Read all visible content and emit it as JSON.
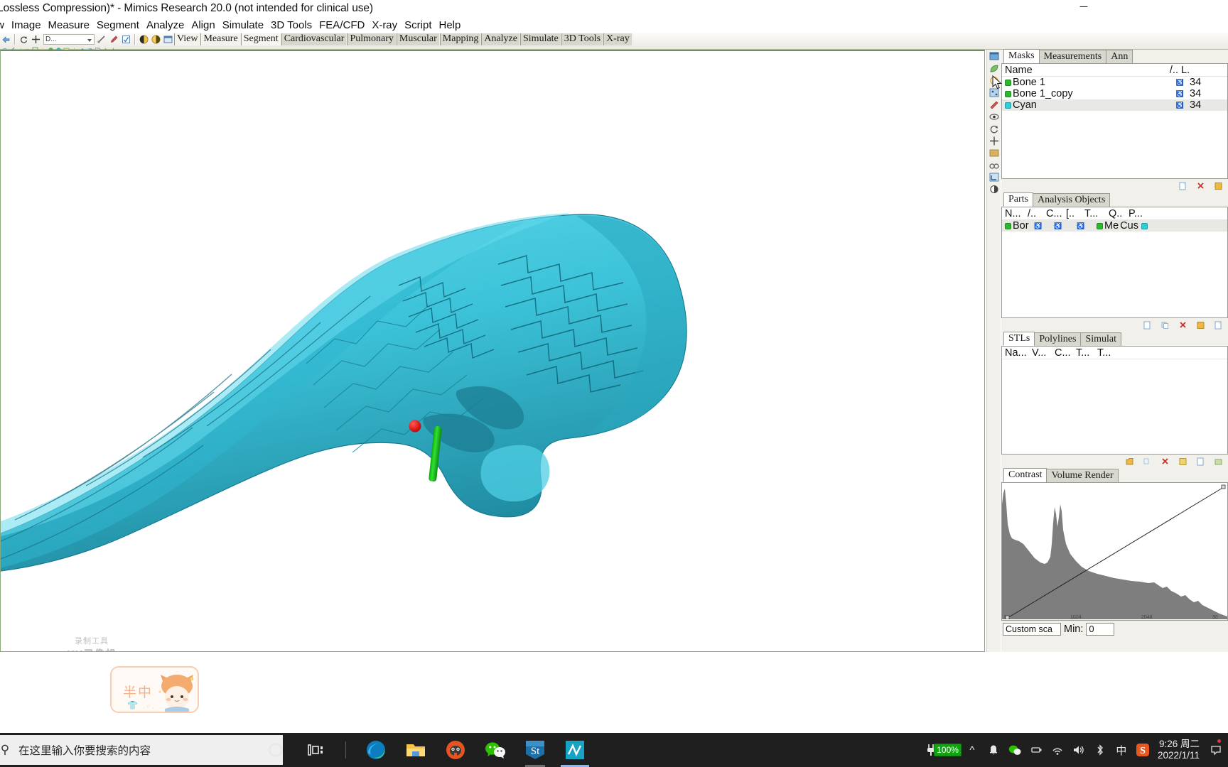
{
  "window": {
    "title": "Lossless Compression)* - Mimics Research 20.0 (not intended for clinical use)",
    "minimize_glyph": "─"
  },
  "menubar": {
    "items": [
      {
        "label": "w"
      },
      {
        "label": "Image"
      },
      {
        "label": "Measure"
      },
      {
        "label": "Segment"
      },
      {
        "label": "Analyze"
      },
      {
        "label": "Align"
      },
      {
        "label": "Simulate"
      },
      {
        "label": "3D Tools"
      },
      {
        "label": "FEA/CFD"
      },
      {
        "label": "X-ray"
      },
      {
        "label": "Script"
      },
      {
        "label": "Help"
      }
    ]
  },
  "toolbar": {
    "combo_value": "D...",
    "ribbon_tabs": [
      {
        "label": "View",
        "active": false
      },
      {
        "label": "Measure",
        "active": false
      },
      {
        "label": "Segment",
        "active": true
      },
      {
        "label": "Cardiovascular",
        "active": false
      },
      {
        "label": "Pulmonary",
        "active": false
      },
      {
        "label": "Muscular",
        "active": false
      },
      {
        "label": "Mapping",
        "active": false
      },
      {
        "label": "Analyze",
        "active": false
      },
      {
        "label": "Simulate",
        "active": false
      },
      {
        "label": "3D Tools",
        "active": false
      },
      {
        "label": "X-ray",
        "active": false
      }
    ]
  },
  "viewport": {
    "watermark_line1": "录制工具",
    "watermark_line2": "KK录像机",
    "mascot_text": "半中",
    "mascot_dots": ", ○ ,",
    "model_color": "#3fc6dd",
    "marker_color": "#e01b1b",
    "axis_color": "#1ec41e"
  },
  "masks_panel": {
    "tabs": [
      {
        "label": "Masks",
        "active": true
      },
      {
        "label": "Measurements",
        "active": false
      },
      {
        "label": "Ann",
        "active": false
      }
    ],
    "columns": [
      "Name",
      "/..",
      "L."
    ],
    "rows": [
      {
        "name": "Bone 1",
        "color": "#2eb82e",
        "visible": "♿",
        "lower": "34",
        "selected": false
      },
      {
        "name": "Bone 1_copy",
        "color": "#2eb82e",
        "visible": "♿",
        "lower": "34",
        "selected": false
      },
      {
        "name": "Cyan",
        "color": "#2ecfd8",
        "visible": "♿",
        "lower": "34",
        "selected": true
      }
    ]
  },
  "parts_panel": {
    "tabs": [
      {
        "label": "Parts",
        "active": true
      },
      {
        "label": "Analysis Objects",
        "active": false
      }
    ],
    "columns": [
      "N...",
      "/..",
      "C...",
      "[..",
      "T...",
      "Q..",
      "P..."
    ],
    "rows": [
      {
        "name": "Bor",
        "color": "#2eb82e",
        "t_value": "Me",
        "q_value": "Cus",
        "selected": true
      }
    ]
  },
  "stls_panel": {
    "tabs": [
      {
        "label": "STLs",
        "active": true
      },
      {
        "label": "Polylines",
        "active": false
      },
      {
        "label": "Simulat",
        "active": false
      }
    ],
    "columns": [
      "Na...",
      "V...",
      "C...",
      "T...",
      "T..."
    ],
    "rows": []
  },
  "contrast_panel": {
    "tabs": [
      {
        "label": "Contrast",
        "active": true
      },
      {
        "label": "Volume Render",
        "active": false
      }
    ],
    "axis_ticks": [
      "1",
      "1024",
      "2048",
      "30"
    ],
    "scale_value": "Custom sca",
    "min_label": "Min:",
    "min_value": "0"
  },
  "taskbar": {
    "search_placeholder": "在这里输入你要搜索的内容",
    "search_icon": "search-icon",
    "apps": [
      {
        "name": "cortana-icon",
        "label": "Cortana"
      },
      {
        "name": "task-view-icon",
        "label": "Task View"
      },
      {
        "name": "edge-icon",
        "label": "Microsoft Edge"
      },
      {
        "name": "file-explorer-icon",
        "label": "File Explorer"
      },
      {
        "name": "browser-icon",
        "label": "Browser"
      },
      {
        "name": "wechat-icon",
        "label": "WeChat"
      },
      {
        "name": "stata-icon",
        "label": "St"
      },
      {
        "name": "mimics-icon",
        "label": "Mimics"
      }
    ],
    "tray": {
      "battery_pct": "100%",
      "ime_label": "中",
      "sogou_label": "S",
      "time": "9:26 周二",
      "date": "2022/1/11"
    }
  }
}
